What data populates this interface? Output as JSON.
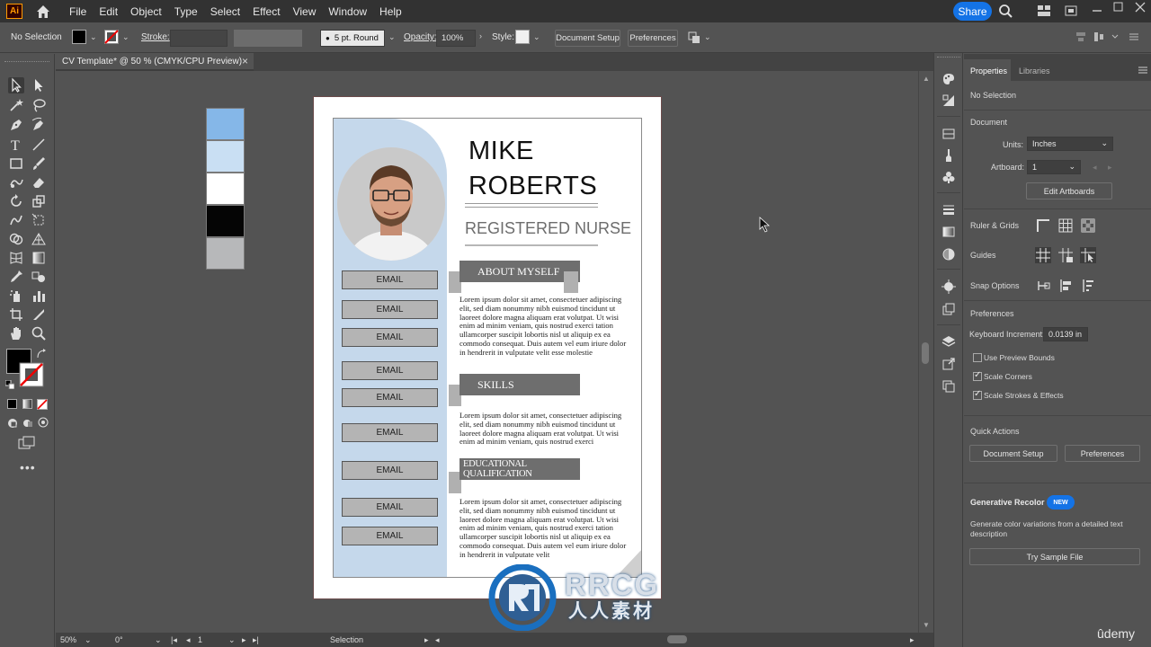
{
  "app": {
    "logo": "Ai"
  },
  "menu": [
    "File",
    "Edit",
    "Object",
    "Type",
    "Select",
    "Effect",
    "View",
    "Window",
    "Help"
  ],
  "share_label": "Share",
  "control": {
    "selection_status": "No Selection",
    "stroke_label": "Stroke:",
    "brush_value": "5 pt. Round",
    "opacity_label": "Opacity:",
    "opacity_value": "100%",
    "style_label": "Style:",
    "doc_setup_label": "Document Setup",
    "preferences_label": "Preferences"
  },
  "doc_tab": {
    "title": "CV Template* @ 50 % (CMYK/CPU Preview)",
    "close": "×"
  },
  "swatches": [
    "#85b7e8",
    "#c9dff3",
    "#ffffff",
    "#050505",
    "#b7b8ba"
  ],
  "resume": {
    "first_name": "MIKE",
    "last_name": "ROBERTS",
    "job_title": "REGISTERED NURSE",
    "emails": [
      "EMAIL",
      "EMAIL",
      "EMAIL",
      "EMAIL",
      "EMAIL",
      "EMAIL",
      "EMAIL",
      "EMAIL",
      "EMAIL"
    ],
    "sections": [
      {
        "heading": "ABOUT MYSELF",
        "body": "Lorem ipsum dolor sit amet, consectetuer adipiscing elit, sed diam nonummy nibh euismod tincidunt ut laoreet dolore magna aliquam erat volutpat. Ut wisi enim ad minim veniam, quis nostrud exerci tation ullamcorper suscipit lobortis nisl ut aliquip ex ea commodo consequat. Duis autem vel eum iriure dolor in hendrerit in vulputate velit esse molestie"
      },
      {
        "heading": "SKILLS",
        "body": "Lorem ipsum dolor sit amet, consectetuer adipiscing elit, sed diam nonummy nibh euismod tincidunt ut laoreet dolore magna aliquam erat volutpat. Ut wisi enim ad minim veniam, quis nostrud exerci"
      },
      {
        "heading": "EDUCATIONAL QUALIFICATION",
        "body": "Lorem ipsum dolor sit amet, consectetuer adipiscing elit, sed diam nonummy nibh euismod tincidunt ut laoreet dolore magna aliquam erat volutpat. Ut wisi enim ad minim veniam, quis nostrud exerci tation ullamcorper suscipit lobortis nisl ut aliquip ex ea commodo consequat. Duis autem vel eum iriure dolor in hendrerit in vulputate velit"
      }
    ]
  },
  "status": {
    "zoom": "50%",
    "rotation": "0°",
    "artboard": "1",
    "tool": "Selection"
  },
  "properties": {
    "tabs": [
      "Properties",
      "Libraries"
    ],
    "no_selection": "No Selection",
    "document_heading": "Document",
    "units_label": "Units:",
    "units_value": "Inches",
    "artboard_label": "Artboard:",
    "artboard_value": "1",
    "edit_artboards": "Edit Artboards",
    "ruler_grids": "Ruler & Grids",
    "guides": "Guides",
    "snap_options": "Snap Options",
    "preferences_heading": "Preferences",
    "keyboard_increment_label": "Keyboard Increment:",
    "keyboard_increment_value": "0.0139 in",
    "use_preview_bounds": "Use Preview Bounds",
    "scale_corners": "Scale Corners",
    "scale_strokes": "Scale Strokes & Effects",
    "quick_actions": "Quick Actions",
    "doc_setup_btn": "Document Setup",
    "preferences_btn": "Preferences",
    "gen_recolor": "Generative Recolor",
    "new_badge": "NEW",
    "gen_desc": "Generate color variations from a detailed text description",
    "try_sample": "Try Sample File"
  },
  "watermark": {
    "latin": "RRCG",
    "cjk": "人人素材"
  },
  "udemy": "ûdemy"
}
